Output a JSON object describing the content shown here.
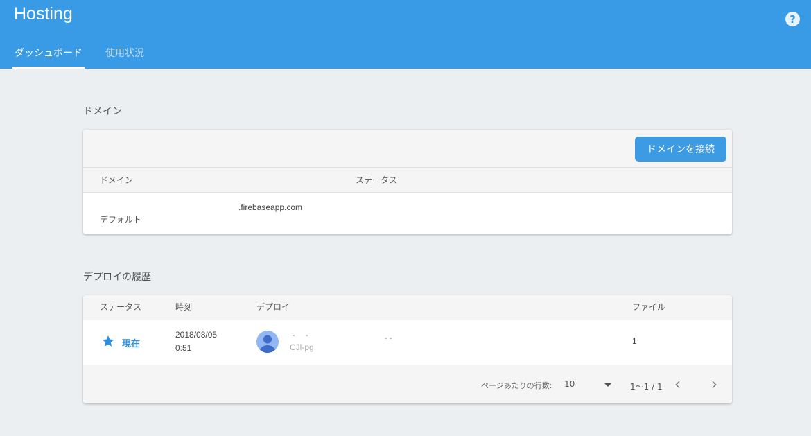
{
  "header": {
    "title": "Hosting",
    "help_icon": "help-circle-icon"
  },
  "tabs": [
    {
      "label": "ダッシュボード",
      "active": true
    },
    {
      "label": "使用状況",
      "active": false
    }
  ],
  "domains": {
    "section_title": "ドメイン",
    "connect_button": "ドメインを接続",
    "columns": [
      "ドメイン",
      "ステータス"
    ],
    "rows": [
      {
        "url": ".firebaseapp.com",
        "status": "デフォルト"
      }
    ]
  },
  "deploy_history": {
    "section_title": "デプロイの履歴",
    "columns": [
      "ステータス",
      "時刻",
      "デプロイ",
      "ファイル"
    ],
    "rows": [
      {
        "status_icon": "star-icon",
        "status": "現在",
        "time_date": "2018/08/05",
        "time_clock": "0:51",
        "deployer_dash_a": "-",
        "deployer_dash_b": "-",
        "deploy_dash": "- -",
        "deploy_id": "CJl-pg",
        "files": "1"
      }
    ],
    "pagination": {
      "rows_per_page_label": "ページあたりの行数:",
      "rows_per_page": "10",
      "range": "1〜1 / 1"
    }
  },
  "colors": {
    "header_bg": "#399be6",
    "accent": "#3d9be4",
    "page_bg": "#eceff1"
  }
}
